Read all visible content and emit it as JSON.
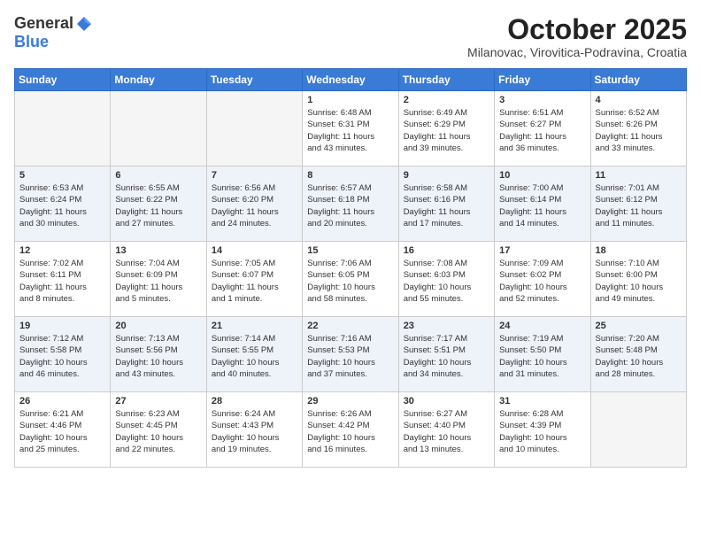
{
  "header": {
    "logo_general": "General",
    "logo_blue": "Blue",
    "month": "October 2025",
    "location": "Milanovac, Virovitica-Podravina, Croatia"
  },
  "weekdays": [
    "Sunday",
    "Monday",
    "Tuesday",
    "Wednesday",
    "Thursday",
    "Friday",
    "Saturday"
  ],
  "weeks": [
    [
      {
        "day": "",
        "info": ""
      },
      {
        "day": "",
        "info": ""
      },
      {
        "day": "",
        "info": ""
      },
      {
        "day": "1",
        "info": "Sunrise: 6:48 AM\nSunset: 6:31 PM\nDaylight: 11 hours\nand 43 minutes."
      },
      {
        "day": "2",
        "info": "Sunrise: 6:49 AM\nSunset: 6:29 PM\nDaylight: 11 hours\nand 39 minutes."
      },
      {
        "day": "3",
        "info": "Sunrise: 6:51 AM\nSunset: 6:27 PM\nDaylight: 11 hours\nand 36 minutes."
      },
      {
        "day": "4",
        "info": "Sunrise: 6:52 AM\nSunset: 6:26 PM\nDaylight: 11 hours\nand 33 minutes."
      }
    ],
    [
      {
        "day": "5",
        "info": "Sunrise: 6:53 AM\nSunset: 6:24 PM\nDaylight: 11 hours\nand 30 minutes."
      },
      {
        "day": "6",
        "info": "Sunrise: 6:55 AM\nSunset: 6:22 PM\nDaylight: 11 hours\nand 27 minutes."
      },
      {
        "day": "7",
        "info": "Sunrise: 6:56 AM\nSunset: 6:20 PM\nDaylight: 11 hours\nand 24 minutes."
      },
      {
        "day": "8",
        "info": "Sunrise: 6:57 AM\nSunset: 6:18 PM\nDaylight: 11 hours\nand 20 minutes."
      },
      {
        "day": "9",
        "info": "Sunrise: 6:58 AM\nSunset: 6:16 PM\nDaylight: 11 hours\nand 17 minutes."
      },
      {
        "day": "10",
        "info": "Sunrise: 7:00 AM\nSunset: 6:14 PM\nDaylight: 11 hours\nand 14 minutes."
      },
      {
        "day": "11",
        "info": "Sunrise: 7:01 AM\nSunset: 6:12 PM\nDaylight: 11 hours\nand 11 minutes."
      }
    ],
    [
      {
        "day": "12",
        "info": "Sunrise: 7:02 AM\nSunset: 6:11 PM\nDaylight: 11 hours\nand 8 minutes."
      },
      {
        "day": "13",
        "info": "Sunrise: 7:04 AM\nSunset: 6:09 PM\nDaylight: 11 hours\nand 5 minutes."
      },
      {
        "day": "14",
        "info": "Sunrise: 7:05 AM\nSunset: 6:07 PM\nDaylight: 11 hours\nand 1 minute."
      },
      {
        "day": "15",
        "info": "Sunrise: 7:06 AM\nSunset: 6:05 PM\nDaylight: 10 hours\nand 58 minutes."
      },
      {
        "day": "16",
        "info": "Sunrise: 7:08 AM\nSunset: 6:03 PM\nDaylight: 10 hours\nand 55 minutes."
      },
      {
        "day": "17",
        "info": "Sunrise: 7:09 AM\nSunset: 6:02 PM\nDaylight: 10 hours\nand 52 minutes."
      },
      {
        "day": "18",
        "info": "Sunrise: 7:10 AM\nSunset: 6:00 PM\nDaylight: 10 hours\nand 49 minutes."
      }
    ],
    [
      {
        "day": "19",
        "info": "Sunrise: 7:12 AM\nSunset: 5:58 PM\nDaylight: 10 hours\nand 46 minutes."
      },
      {
        "day": "20",
        "info": "Sunrise: 7:13 AM\nSunset: 5:56 PM\nDaylight: 10 hours\nand 43 minutes."
      },
      {
        "day": "21",
        "info": "Sunrise: 7:14 AM\nSunset: 5:55 PM\nDaylight: 10 hours\nand 40 minutes."
      },
      {
        "day": "22",
        "info": "Sunrise: 7:16 AM\nSunset: 5:53 PM\nDaylight: 10 hours\nand 37 minutes."
      },
      {
        "day": "23",
        "info": "Sunrise: 7:17 AM\nSunset: 5:51 PM\nDaylight: 10 hours\nand 34 minutes."
      },
      {
        "day": "24",
        "info": "Sunrise: 7:19 AM\nSunset: 5:50 PM\nDaylight: 10 hours\nand 31 minutes."
      },
      {
        "day": "25",
        "info": "Sunrise: 7:20 AM\nSunset: 5:48 PM\nDaylight: 10 hours\nand 28 minutes."
      }
    ],
    [
      {
        "day": "26",
        "info": "Sunrise: 6:21 AM\nSunset: 4:46 PM\nDaylight: 10 hours\nand 25 minutes."
      },
      {
        "day": "27",
        "info": "Sunrise: 6:23 AM\nSunset: 4:45 PM\nDaylight: 10 hours\nand 22 minutes."
      },
      {
        "day": "28",
        "info": "Sunrise: 6:24 AM\nSunset: 4:43 PM\nDaylight: 10 hours\nand 19 minutes."
      },
      {
        "day": "29",
        "info": "Sunrise: 6:26 AM\nSunset: 4:42 PM\nDaylight: 10 hours\nand 16 minutes."
      },
      {
        "day": "30",
        "info": "Sunrise: 6:27 AM\nSunset: 4:40 PM\nDaylight: 10 hours\nand 13 minutes."
      },
      {
        "day": "31",
        "info": "Sunrise: 6:28 AM\nSunset: 4:39 PM\nDaylight: 10 hours\nand 10 minutes."
      },
      {
        "day": "",
        "info": ""
      }
    ]
  ]
}
